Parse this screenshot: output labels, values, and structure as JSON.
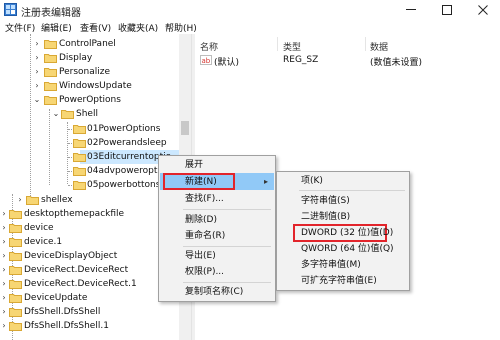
{
  "window": {
    "title": "注册表编辑器"
  },
  "menubar": [
    "文件(F)",
    "编辑(E)",
    "查看(V)",
    "收藏夹(A)",
    "帮助(H)"
  ],
  "tree": [
    {
      "label": "ControlPanel"
    },
    {
      "label": "Display"
    },
    {
      "label": "Personalize"
    },
    {
      "label": "WindowsUpdate"
    },
    {
      "label": "PowerOptions"
    },
    {
      "label": "Shell"
    },
    {
      "label": "01PowerOptions"
    },
    {
      "label": "02Powerandsleep"
    },
    {
      "label": "03Editcurrentoptio"
    },
    {
      "label": "04advpoweroptio"
    },
    {
      "label": "05powerbottons"
    },
    {
      "label": "shellex"
    },
    {
      "label": "desktopthemepackfile"
    },
    {
      "label": "device"
    },
    {
      "label": "device.1"
    },
    {
      "label": "DeviceDisplayObject"
    },
    {
      "label": "DeviceRect.DeviceRect"
    },
    {
      "label": "DeviceRect.DeviceRect.1"
    },
    {
      "label": "DeviceUpdate"
    },
    {
      "label": "DfsShell.DfsShell"
    },
    {
      "label": "DfsShell.DfsShell.1"
    }
  ],
  "list": {
    "headers": {
      "name": "名称",
      "type": "类型",
      "data": "数据"
    },
    "rows": [
      {
        "icon": "ab",
        "name": "(默认)",
        "type": "REG_SZ",
        "data": "(数值未设置)"
      }
    ]
  },
  "context_menu": {
    "items": [
      "展开",
      "新建(N)",
      "查找(F)...",
      "删除(D)",
      "重命名(R)",
      "导出(E)",
      "权限(P)...",
      "复制项名称(C)"
    ]
  },
  "submenu": {
    "items": [
      "项(K)",
      "字符串值(S)",
      "二进制值(B)",
      "DWORD (32 位)值(D)",
      "QWORD (64 位)值(Q)",
      "多字符串值(M)",
      "可扩充字符串值(E)"
    ]
  },
  "colors": {
    "highlight": "#91c9f7",
    "annotation": "#e2242b",
    "selection": "#cce8ff"
  }
}
